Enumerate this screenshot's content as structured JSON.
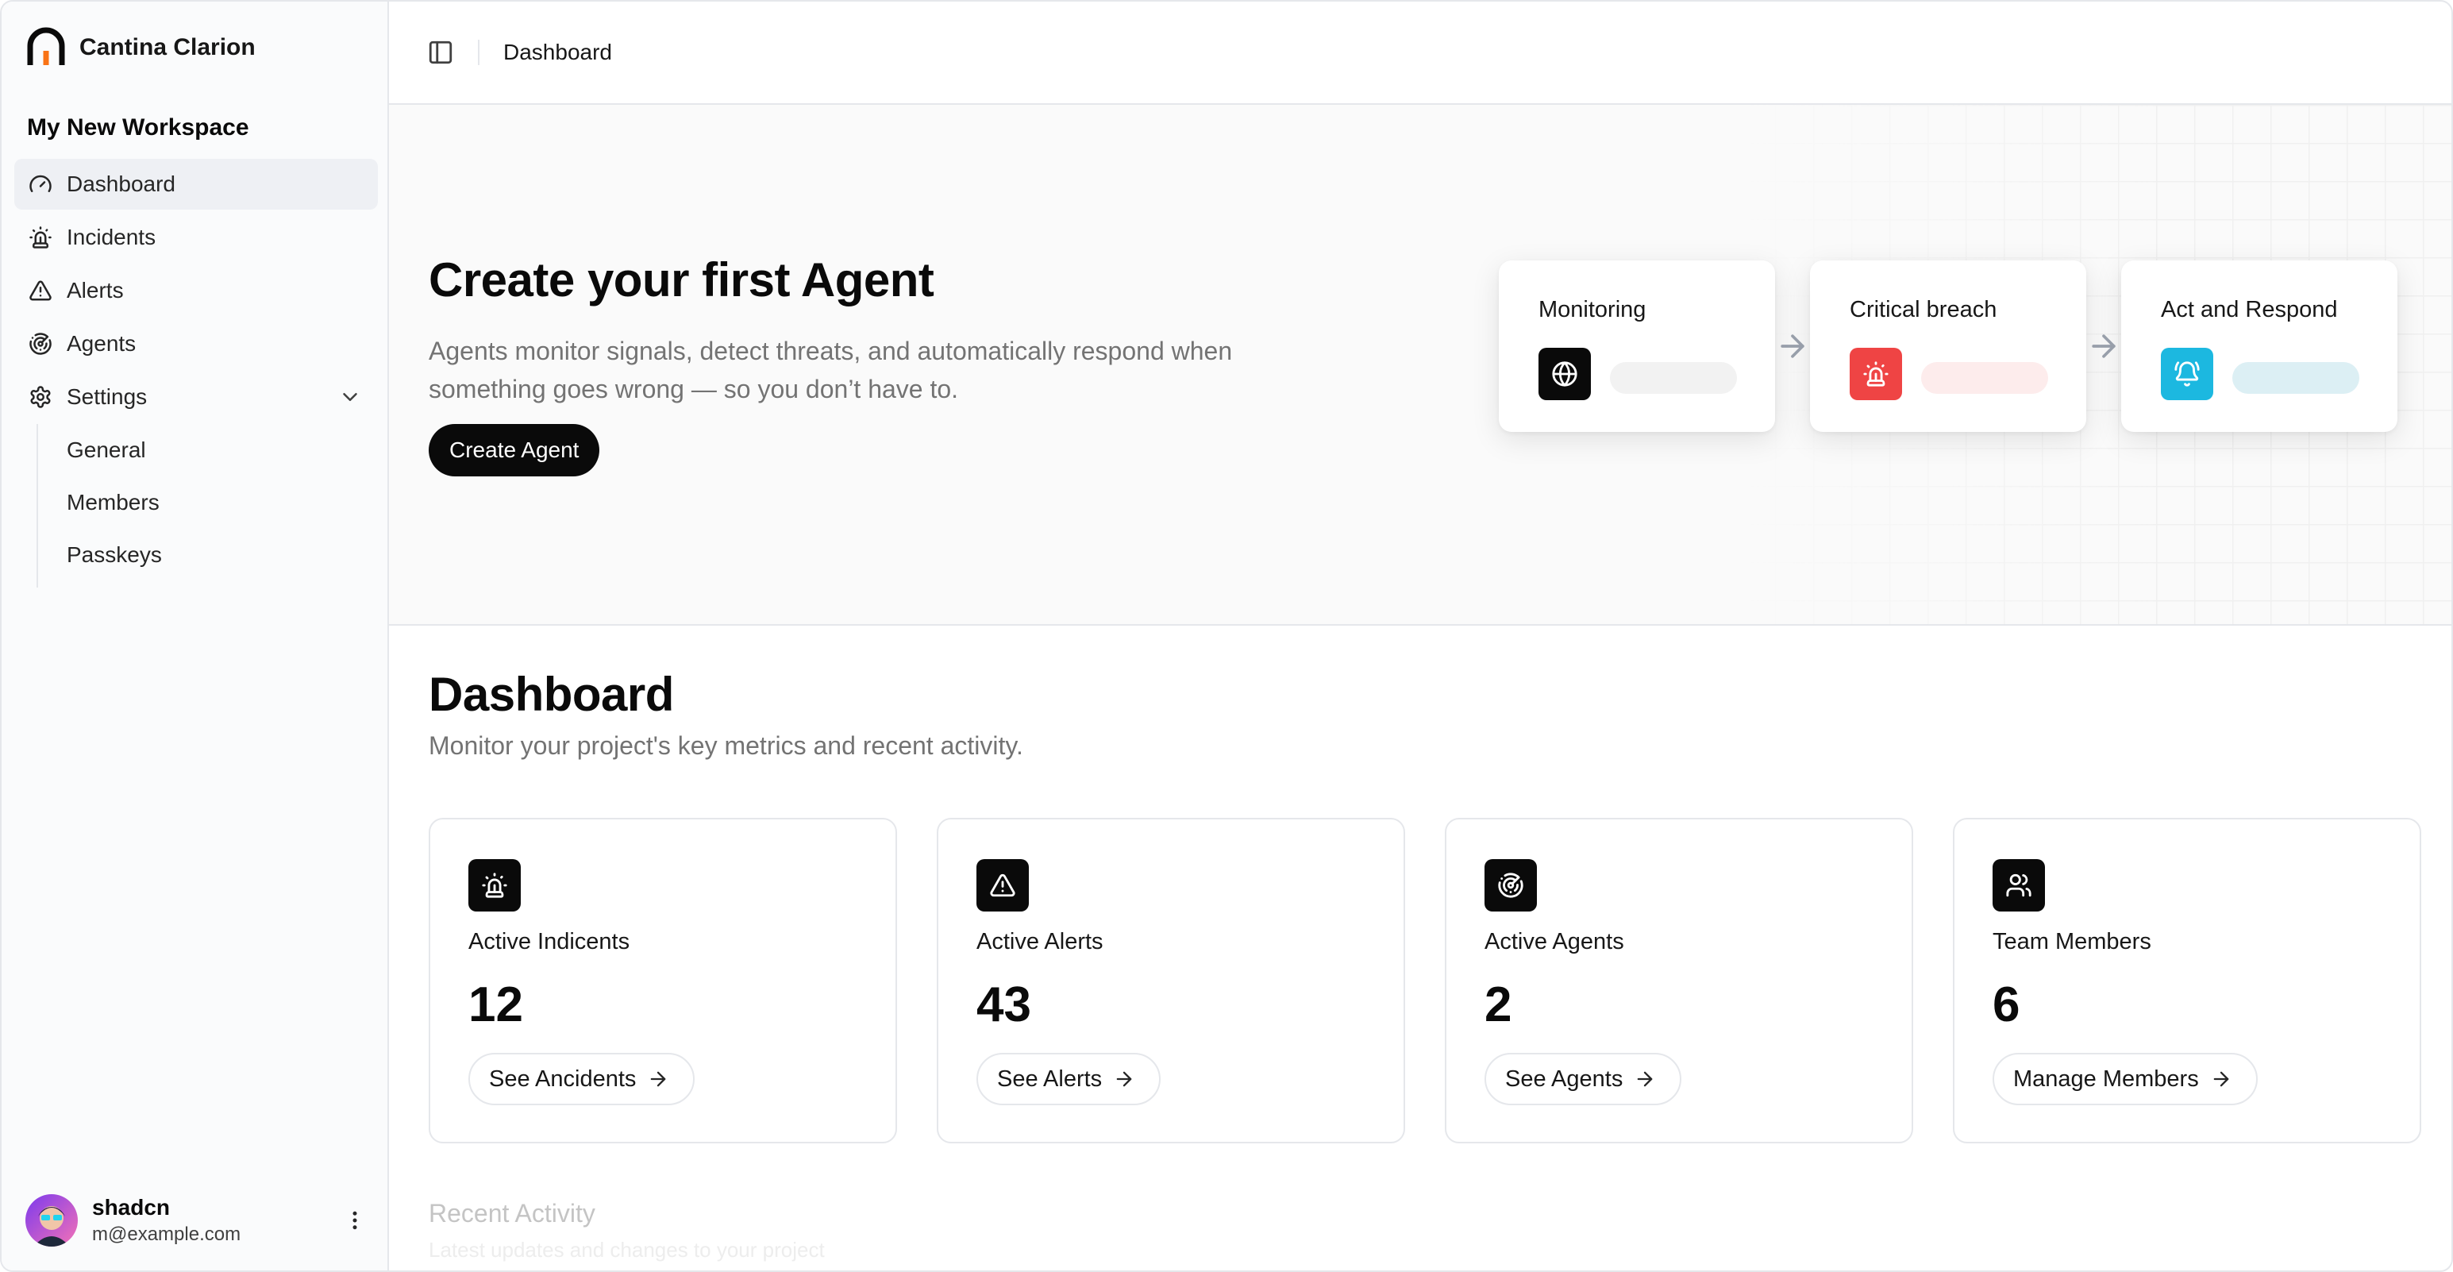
{
  "brand": {
    "name": "Cantina Clarion"
  },
  "workspace": {
    "title": "My New Workspace"
  },
  "sidebar": {
    "items": [
      {
        "label": "Dashboard",
        "icon": "gauge-icon",
        "active": true
      },
      {
        "label": "Incidents",
        "icon": "siren-icon"
      },
      {
        "label": "Alerts",
        "icon": "triangle-alert-icon"
      },
      {
        "label": "Agents",
        "icon": "radar-icon"
      },
      {
        "label": "Settings",
        "icon": "gear-icon",
        "expanded": true
      }
    ],
    "subitems": [
      {
        "label": "General"
      },
      {
        "label": "Members"
      },
      {
        "label": "Passkeys"
      }
    ]
  },
  "user": {
    "name": "shadcn",
    "email": "m@example.com"
  },
  "topbar": {
    "breadcrumb": "Dashboard"
  },
  "hero": {
    "title": "Create your first Agent",
    "description": "Agents monitor signals, detect threats, and automatically respond when something goes wrong — so you don’t have to.",
    "button_label": "Create Agent",
    "flow": [
      {
        "title": "Monitoring",
        "icon": "globe-icon",
        "color": "#0a0a0a",
        "bar_color": "#f2f2f2"
      },
      {
        "title": "Critical breach",
        "icon": "siren-icon",
        "color": "#ef4444",
        "bar_color": "#fdecec"
      },
      {
        "title": "Act and Respond",
        "icon": "bell-ring-icon",
        "color": "#1cb8e0",
        "bar_color": "#dceff4"
      }
    ]
  },
  "dashboard": {
    "title": "Dashboard",
    "subtitle": "Monitor your project's key metrics and recent activity.",
    "cards": [
      {
        "label": "Active Indicents",
        "value": "12",
        "button": "See Ancidents",
        "icon": "siren-icon"
      },
      {
        "label": "Active Alerts",
        "value": "43",
        "button": "See Alerts",
        "icon": "triangle-alert-icon"
      },
      {
        "label": "Active Agents",
        "value": "2",
        "button": "See Agents",
        "icon": "radar-icon"
      },
      {
        "label": "Team Members",
        "value": "6",
        "button": "Manage Members",
        "icon": "users-icon"
      }
    ]
  },
  "recent": {
    "title": "Recent Activity",
    "subtitle": "Latest updates and changes to your project"
  }
}
